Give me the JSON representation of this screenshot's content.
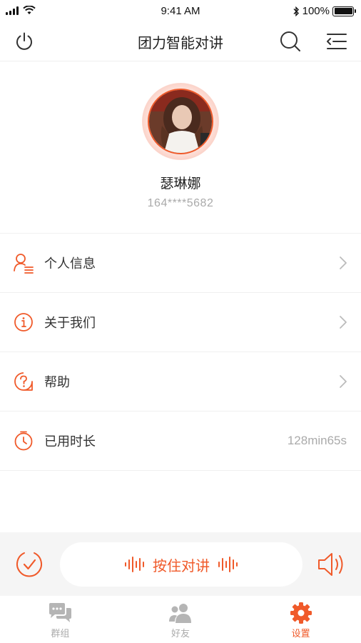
{
  "status_bar": {
    "time": "9:41 AM",
    "battery": "100%"
  },
  "header": {
    "title": "团力智能对讲"
  },
  "profile": {
    "name": "瑟琳娜",
    "phone": "164****5682"
  },
  "menu": [
    {
      "label": "个人信息",
      "icon": "user-info-icon"
    },
    {
      "label": "关于我们",
      "icon": "info-circle-icon"
    },
    {
      "label": "帮助",
      "icon": "help-icon"
    },
    {
      "label": "已用时长",
      "icon": "timer-icon",
      "value": "128min65s"
    }
  ],
  "ptt": {
    "label": "按住对讲"
  },
  "tabs": [
    {
      "label": "群组",
      "icon": "chat-icon",
      "active": false
    },
    {
      "label": "好友",
      "icon": "friends-icon",
      "active": false
    },
    {
      "label": "设置",
      "icon": "settings-gear-icon",
      "active": true
    }
  ],
  "colors": {
    "accent": "#f05a2a",
    "muted": "#aaaaaa",
    "divider": "#f0f0f0"
  }
}
